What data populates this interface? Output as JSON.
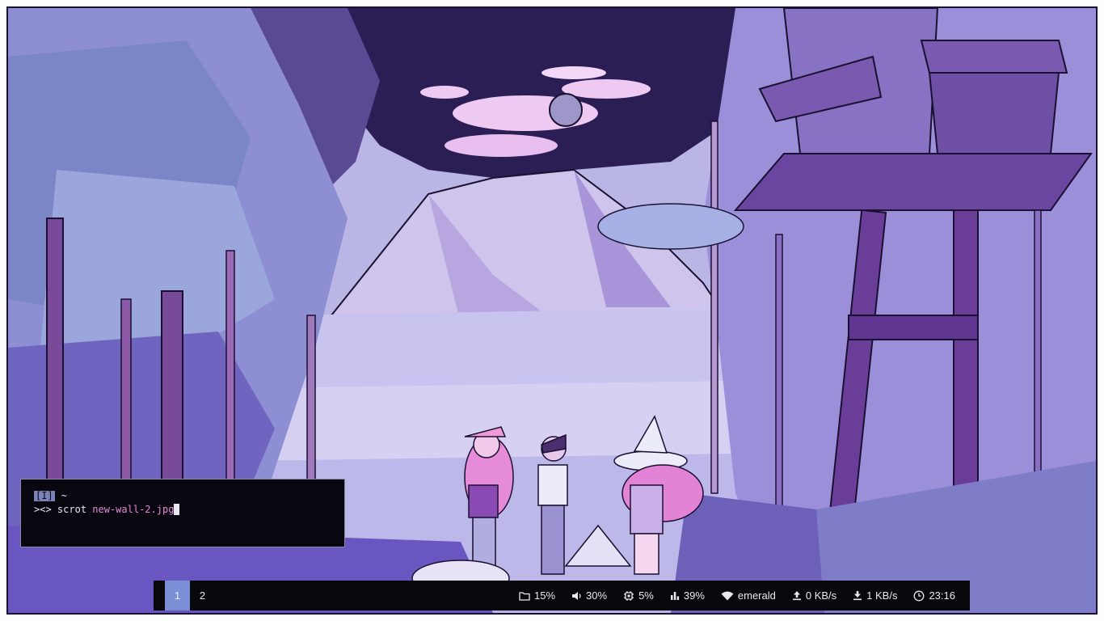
{
  "terminal": {
    "mode_indicator": "[I]",
    "cwd": "~",
    "prompt": "><>",
    "command": "scrot",
    "argument": "new-wall-2.jpg"
  },
  "workspaces": [
    {
      "label": "1",
      "active": true
    },
    {
      "label": "2",
      "active": false
    }
  ],
  "status": {
    "disk": {
      "icon": "folder-icon",
      "value": "15%"
    },
    "volume": {
      "icon": "speaker-icon",
      "value": "30%"
    },
    "cpu": {
      "icon": "cpu-icon",
      "value": "5%"
    },
    "memory": {
      "icon": "bar-chart-icon",
      "value": "39%"
    },
    "wifi": {
      "icon": "wifi-icon",
      "value": "emerald"
    },
    "upload": {
      "icon": "upload-icon",
      "value": "0 KB/s"
    },
    "download": {
      "icon": "download-icon",
      "value": "1 KB/s"
    },
    "clock": {
      "icon": "clock-icon",
      "value": "23:16"
    }
  },
  "colors": {
    "bar_bg": "#07070c",
    "active_workspace": "#7b8fd6",
    "terminal_bg": "#08070f",
    "arg_highlight": "#e48ad8"
  }
}
